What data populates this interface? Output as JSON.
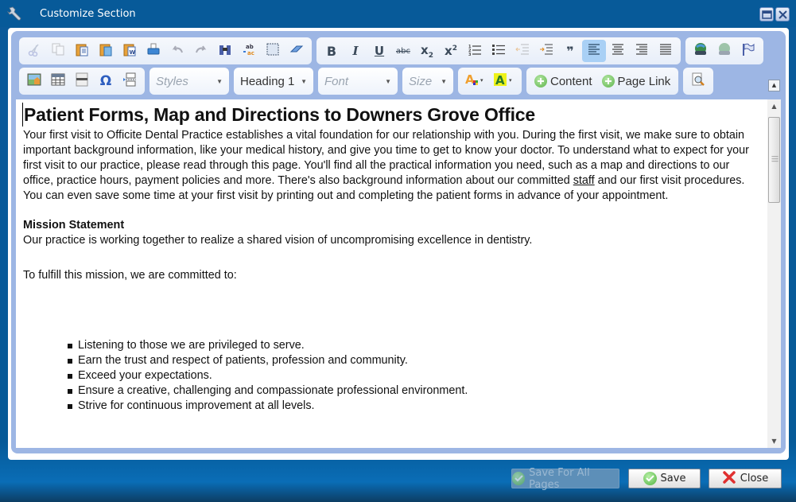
{
  "window": {
    "title": "Customize Section",
    "icons": {
      "app": "wrench-icon",
      "maximize": "maximize-icon",
      "close": "close-icon"
    }
  },
  "toolbar": {
    "row1": {
      "clipboard_group": [
        {
          "name": "cut",
          "icon": "scissors-icon",
          "label": "Cut",
          "state": "disabled"
        },
        {
          "name": "copy",
          "icon": "copy-icon",
          "label": "Copy",
          "state": "disabled"
        },
        {
          "name": "paste",
          "icon": "paste-icon",
          "label": "Paste",
          "state": "enabled"
        },
        {
          "name": "paste-text",
          "icon": "paste-text-icon",
          "label": "Paste as plain text",
          "state": "enabled"
        },
        {
          "name": "paste-word",
          "icon": "paste-word-icon",
          "label": "Paste from Word",
          "state": "enabled"
        },
        {
          "name": "print",
          "icon": "print-icon",
          "label": "Print",
          "state": "enabled"
        },
        {
          "name": "undo",
          "icon": "undo-icon",
          "label": "Undo",
          "state": "disabled"
        },
        {
          "name": "redo",
          "icon": "redo-icon",
          "label": "Redo",
          "state": "disabled"
        },
        {
          "name": "find",
          "icon": "binoculars-icon",
          "label": "Find",
          "state": "enabled"
        },
        {
          "name": "replace",
          "icon": "replace-icon",
          "label": "Replace",
          "state": "enabled"
        },
        {
          "name": "select-all",
          "icon": "select-all-icon",
          "label": "Select All",
          "state": "enabled"
        },
        {
          "name": "remove-format",
          "icon": "eraser-icon",
          "label": "Remove Format",
          "state": "enabled"
        }
      ],
      "format_group": [
        {
          "name": "bold",
          "icon": "bold-icon",
          "glyph": "B"
        },
        {
          "name": "italic",
          "icon": "italic-icon",
          "glyph": "I"
        },
        {
          "name": "underline",
          "icon": "underline-icon",
          "glyph": "U"
        },
        {
          "name": "strikethrough",
          "icon": "strikethrough-icon",
          "glyph": "abc"
        },
        {
          "name": "subscript",
          "icon": "subscript-icon",
          "glyph": "x₂"
        },
        {
          "name": "superscript",
          "icon": "superscript-icon",
          "glyph": "x²"
        },
        {
          "name": "numbered-list",
          "icon": "numbered-list-icon",
          "glyph": ""
        },
        {
          "name": "bulleted-list",
          "icon": "bulleted-list-icon",
          "glyph": ""
        },
        {
          "name": "outdent",
          "icon": "outdent-icon",
          "glyph": "",
          "state": "disabled"
        },
        {
          "name": "indent",
          "icon": "indent-icon",
          "glyph": ""
        },
        {
          "name": "blockquote",
          "icon": "quote-icon",
          "glyph": "❞"
        },
        {
          "name": "align-left",
          "icon": "align-left-icon",
          "glyph": "",
          "state": "active"
        },
        {
          "name": "align-center",
          "icon": "align-center-icon",
          "glyph": ""
        },
        {
          "name": "align-right",
          "icon": "align-right-icon",
          "glyph": ""
        },
        {
          "name": "justify",
          "icon": "justify-icon",
          "glyph": ""
        }
      ],
      "link_group": [
        {
          "name": "link",
          "icon": "link-icon",
          "state": "enabled"
        },
        {
          "name": "unlink",
          "icon": "unlink-icon",
          "state": "disabled"
        },
        {
          "name": "anchor",
          "icon": "flag-icon",
          "state": "enabled"
        }
      ]
    },
    "row2": {
      "insert_group": [
        {
          "name": "image",
          "icon": "image-icon"
        },
        {
          "name": "table",
          "icon": "table-icon"
        },
        {
          "name": "horizontal-rule",
          "icon": "horizontal-rule-icon"
        },
        {
          "name": "special-char",
          "icon": "omega-icon"
        },
        {
          "name": "page-break",
          "icon": "page-break-icon"
        }
      ],
      "styles": {
        "placeholder": "Styles"
      },
      "format": {
        "value": "Heading 1"
      },
      "font": {
        "placeholder": "Font"
      },
      "size": {
        "placeholder": "Size"
      },
      "colors": [
        {
          "name": "text-color",
          "icon": "text-color-icon"
        },
        {
          "name": "bg-color",
          "icon": "background-color-icon"
        }
      ],
      "content_button": "Content",
      "page_link_button": "Page Link",
      "preview": {
        "icon": "preview-icon"
      }
    }
  },
  "document": {
    "heading": "Patient Forms, Map and Directions to Downers Grove Office",
    "intro_part1": "Your first visit to Officite Dental Practice establishes a vital foundation for our relationship with you. During the first visit, we make sure to obtain important background information, like your medical history, and give you time to get to know your doctor. To understand what to expect for your first visit to our practice, please read through this page. You'll find all the practical information you need, such as a map and directions to our office, practice hours, payment policies and more. There's also background information about our committed ",
    "intro_link": "staff",
    "intro_part2": " and our first visit procedures. You can even save some time at your first visit by printing out and completing the patient forms in advance of your appointment.",
    "mission_heading": "Mission Statement",
    "mission_text": "Our practice is working together to realize a shared vision of uncompromising excellence in dentistry.",
    "fulfill_text": "To fulfill this mission, we are committed to:",
    "commitments": [
      "Listening to those we are privileged to serve.",
      "Earn the trust and respect of patients, profession and community.",
      "Exceed your expectations.",
      "Ensure a creative, challenging and compassionate professional environment.",
      "Strive for continuous improvement at all levels."
    ]
  },
  "footer": {
    "save_all": {
      "label": "Save For All Pages",
      "state": "disabled"
    },
    "save": {
      "label": "Save"
    },
    "close": {
      "label": "Close"
    }
  }
}
